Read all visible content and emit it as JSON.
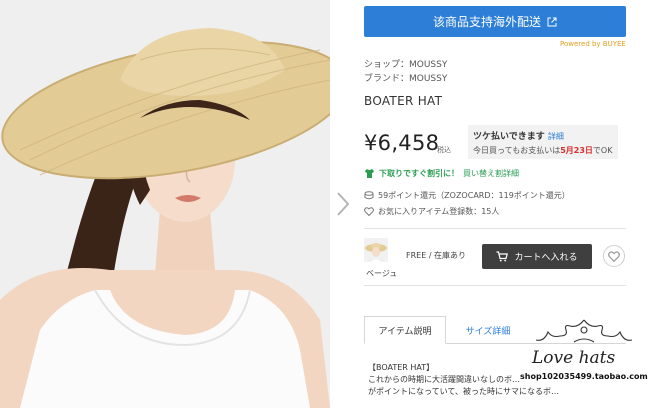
{
  "shipping": {
    "button_label": "该商品支持海外配送",
    "powered_by": "Powered by BUYEE"
  },
  "product": {
    "shop_line": "ショップ：MOUSSY",
    "brand_line": "ブランド：MOUSSY",
    "name": "BOATER HAT",
    "price": "¥6,458",
    "tax_label": "税込"
  },
  "tsuke": {
    "title": "ツケ払いできます",
    "detail_link": "詳細",
    "line_prefix": "今日買ってもお支払いは",
    "line_date": "5月23日",
    "line_suffix": "でOK"
  },
  "sale": {
    "text": "下取りですぐ割引に！",
    "link": "買い替え割詳細"
  },
  "points": {
    "text": "59ポイント還元（ZOZOCARD：119ポイント還元）"
  },
  "favorites": {
    "text": "お気に入りアイテム登録数：15人"
  },
  "variant": {
    "color_name": "ベージュ",
    "stock": "FREE / 在庫あり",
    "cart_label": "カートへ入れる"
  },
  "tabs": [
    {
      "label": "アイテム説明"
    },
    {
      "label": "サイズ詳細"
    }
  ],
  "description": {
    "title": "【BOATER HAT】",
    "lines": [
      "これからの時期に大活躍間違いなしのボ…",
      "がポイントになっていて、被った時にサマになるボ…"
    ]
  },
  "watermark": {
    "title": "Love hats",
    "shop": "shop102035499.taobao.com"
  },
  "colors": {
    "ship_blue": "#2d7ed6",
    "cart_dark": "#3f3f3f",
    "sale_green": "#2a9d52",
    "date_red": "#d92c2c"
  }
}
